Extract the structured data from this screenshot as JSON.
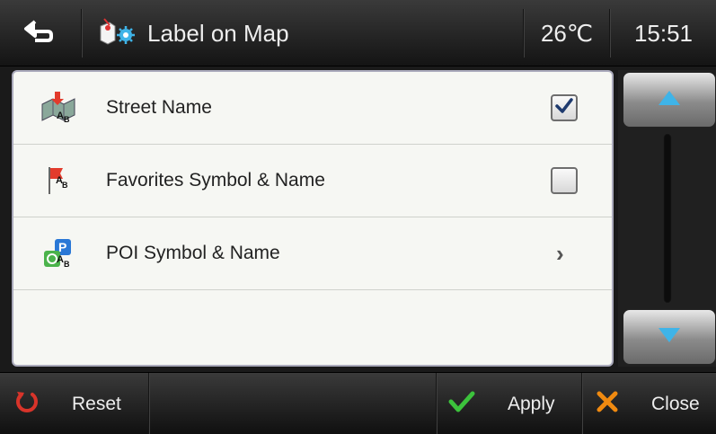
{
  "header": {
    "title": "Label on Map",
    "temperature": "26℃",
    "time": "15:51",
    "back_icon": "back-arrow-icon",
    "title_icon": "map-label-settings-icon"
  },
  "list": {
    "items": [
      {
        "label": "Street Name",
        "icon": "street-name-icon",
        "control": "checkbox",
        "checked": true
      },
      {
        "label": "Favorites Symbol & Name",
        "icon": "favorites-flag-icon",
        "control": "checkbox",
        "checked": false
      },
      {
        "label": "POI Symbol & Name",
        "icon": "poi-icon",
        "control": "chevron",
        "checked": null
      }
    ]
  },
  "footer": {
    "reset_label": "Reset",
    "apply_label": "Apply",
    "close_label": "Close"
  },
  "colors": {
    "accent_blue": "#3fb4e8",
    "apply_green": "#3cc23c",
    "close_orange": "#f08a10",
    "reset_red": "#d8342a"
  }
}
